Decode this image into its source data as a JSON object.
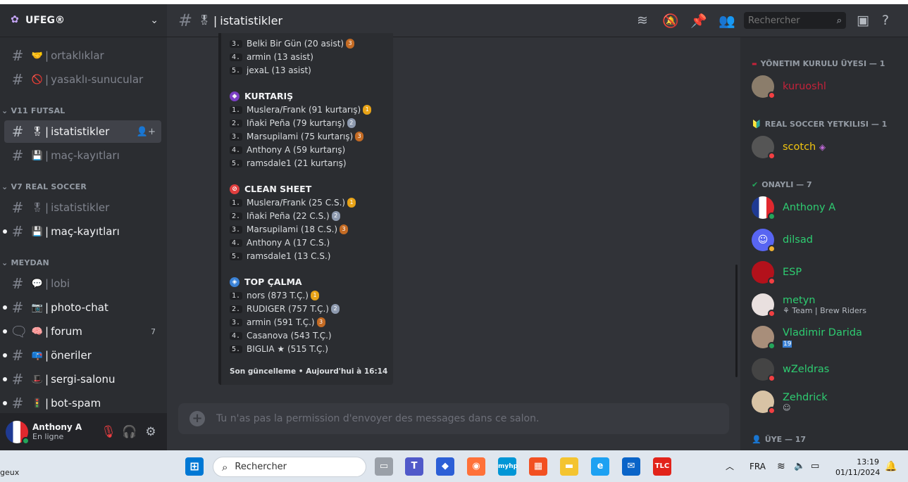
{
  "server": {
    "name": "UFEG®"
  },
  "channels": {
    "ortakliklar": "ortaklıklar",
    "yasakli": "yasaklı-sunucular",
    "cat_futsal": "V11 FUTSAL",
    "istatistikler1": "istatistikler",
    "mac_kayitlari1": "maç-kayıtları",
    "cat_real": "V7 REAL SOCCER",
    "istatistikler2": "istatistikler",
    "mac_kayitlari2": "maç-kayıtları",
    "cat_meydan": "MEYDAN",
    "lobi": "lobi",
    "photo_chat": "photo-chat",
    "forum": "forum",
    "forum_count": "7",
    "oneriler": "öneriler",
    "sergi": "sergi-salonu",
    "bot_spam": "bot-spam"
  },
  "user": {
    "name": "Anthony A",
    "status": "En ligne"
  },
  "topbar": {
    "channel": "istatistikler",
    "search_placeholder": "Rechercher"
  },
  "embed": {
    "assist_lines": [
      {
        "rank": "3.",
        "text": "Belki Bir Gün (20 asist)",
        "medal": "3"
      },
      {
        "rank": "4.",
        "text": "armin (13 asist)"
      },
      {
        "rank": "5.",
        "text": "jexaL (13 asist)"
      }
    ],
    "kurtaris": {
      "title": "KURTARIŞ",
      "lines": [
        {
          "rank": "1.",
          "text": "Muslera/Frank (91 kurtarış)",
          "medal": "1"
        },
        {
          "rank": "2.",
          "text": "Iñaki Peña (79 kurtarış)",
          "medal": "2"
        },
        {
          "rank": "3.",
          "text": "Marsupilami (75 kurtarış)",
          "medal": "3"
        },
        {
          "rank": "4.",
          "text": "Anthony A (59 kurtarış)"
        },
        {
          "rank": "5.",
          "text": "ramsdale1 (21 kurtarış)"
        }
      ]
    },
    "clean_sheet": {
      "title": "CLEAN SHEET",
      "lines": [
        {
          "rank": "1.",
          "text": "Muslera/Frank (25 C.S.)",
          "medal": "1"
        },
        {
          "rank": "2.",
          "text": "Iñaki Peña (22 C.S.)",
          "medal": "2"
        },
        {
          "rank": "3.",
          "text": "Marsupilami (18 C.S.)",
          "medal": "3"
        },
        {
          "rank": "4.",
          "text": "Anthony A (17 C.S.)"
        },
        {
          "rank": "5.",
          "text": "ramsdale1 (13 C.S.)"
        }
      ]
    },
    "top_calma": {
      "title": "TOP ÇALMA",
      "lines": [
        {
          "rank": "1.",
          "text": "nors (873 T.Ç.)",
          "medal": "1"
        },
        {
          "rank": "2.",
          "text": "RUDIGER (757 T.Ç.)",
          "medal": "2"
        },
        {
          "rank": "3.",
          "text": "armin (591 T.Ç.)",
          "medal": "3"
        },
        {
          "rank": "4.",
          "text": "Casanova (543 T.Ç.)"
        },
        {
          "rank": "5.",
          "text": "BIGLIA ★ (515 T.Ç.)"
        }
      ]
    },
    "footer": "Son güncelleme • Aujourd'hui à 16:14"
  },
  "composer": {
    "placeholder": "Tu n'as pas la permission d'envoyer des messages dans ce salon."
  },
  "members": {
    "cat1": "YÖNETIM KURULU ÜYESI — 1",
    "cat2": "REAL SOCCER YETKILISI — 1",
    "cat3": "ONAYLI — 7",
    "cat4": "ÜYE — 17",
    "list": [
      {
        "name": "kuruoshl",
        "color": "#c4223a"
      },
      {
        "name": "scotch",
        "color": "#f1c40f"
      },
      {
        "name": "Anthony A",
        "color": "#2ecc71"
      },
      {
        "name": "dilsad",
        "color": "#2ecc71"
      },
      {
        "name": "ESP",
        "color": "#2ecc71"
      },
      {
        "name": "metyn",
        "color": "#2ecc71",
        "sub": "Team | Brew Riders"
      },
      {
        "name": "Vladimir Darida",
        "color": "#2ecc71",
        "sub": "19"
      },
      {
        "name": "wZeldras",
        "color": "#2ecc71"
      },
      {
        "name": "Zehdrick",
        "color": "#2ecc71"
      }
    ]
  },
  "taskbar": {
    "left_text": "geux",
    "search": "Rechercher",
    "lang": "FRA",
    "time": "13:19",
    "date": "01/11/2024"
  }
}
